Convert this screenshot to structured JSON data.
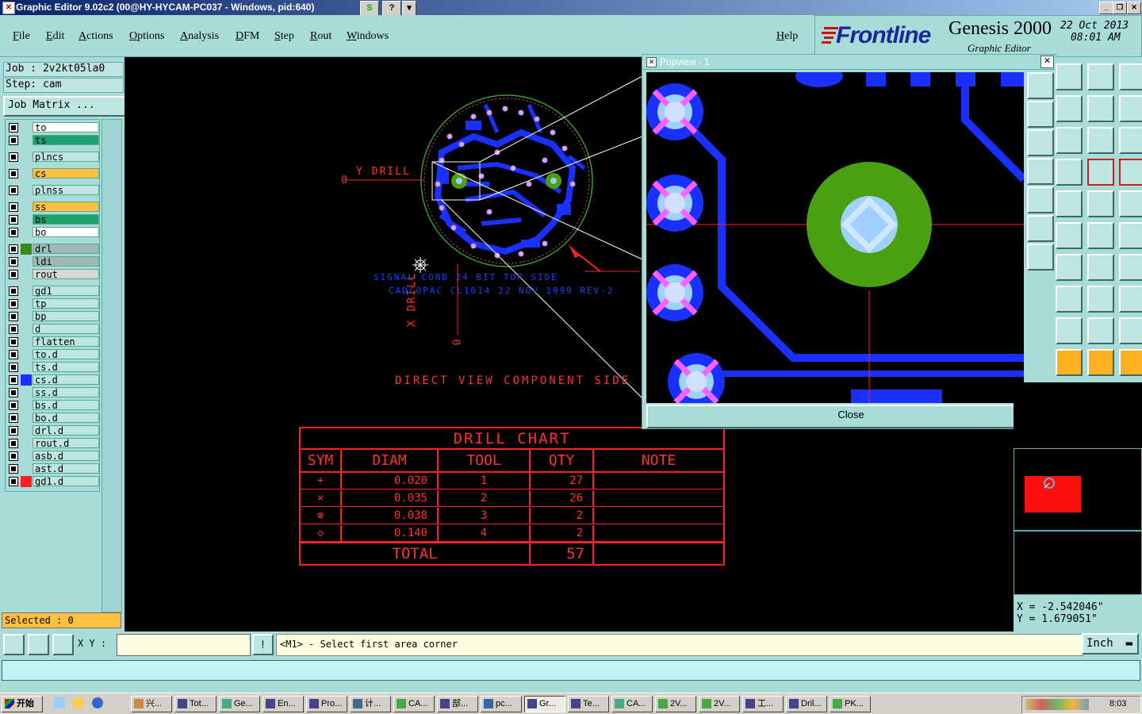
{
  "window": {
    "title": "Graphic Editor 9.02c2 (00@HY-HYCAM-PC037 - Windows, pid:640)",
    "qbtn1": "S",
    "qbtn2": "?",
    "qbtn3": "▾"
  },
  "menu": [
    "File",
    "Edit",
    "Actions",
    "Options",
    "Analysis",
    "DFM",
    "Step",
    "Rout",
    "Windows"
  ],
  "help": "Help",
  "logo": {
    "brand": "Frontline",
    "product": "Genesis 2000",
    "subtitle": "Graphic Editor",
    "date": "22 Oct 2013",
    "time": "08:01 AM"
  },
  "job": {
    "job": "Job : 2v2kt05la0",
    "step": "Step: cam",
    "matrix_button": "Job Matrix ..."
  },
  "layers": [
    {
      "name": "to",
      "color": "#ffffff",
      "gap": false
    },
    {
      "name": "ts",
      "color": "#1fa070",
      "gap": false
    },
    {
      "name": "plncs",
      "color": "#bde6e2",
      "gap": true
    },
    {
      "name": "cs",
      "color": "#ffc040",
      "gap": true
    },
    {
      "name": "plnss",
      "color": "#bde6e2",
      "gap": true
    },
    {
      "name": "ss",
      "color": "#ffc040",
      "gap": true
    },
    {
      "name": "bs",
      "color": "#1fa070",
      "gap": false
    },
    {
      "name": "bo",
      "color": "#ffffff",
      "gap": false
    },
    {
      "name": "drl",
      "color": "#a0b8b8",
      "gap": true,
      "swatch": "#3a8a1a"
    },
    {
      "name": "ldi",
      "color": "#a0b8b8",
      "gap": false
    },
    {
      "name": "rout",
      "color": "#d8d8d8",
      "gap": false
    },
    {
      "name": "gd1",
      "color": "#bde6e2",
      "gap": true
    },
    {
      "name": "tp",
      "color": "#bde6e2",
      "gap": false
    },
    {
      "name": "bp",
      "color": "#bde6e2",
      "gap": false
    },
    {
      "name": "d",
      "color": "#bde6e2",
      "gap": false
    },
    {
      "name": "flatten",
      "color": "#bde6e2",
      "gap": false
    },
    {
      "name": "to.d",
      "color": "#bde6e2",
      "gap": false
    },
    {
      "name": "ts.d",
      "color": "#bde6e2",
      "gap": false
    },
    {
      "name": "cs.d",
      "color": "#bde6e2",
      "gap": false,
      "swatch": "#1a30ff"
    },
    {
      "name": "ss.d",
      "color": "#bde6e2",
      "gap": false
    },
    {
      "name": "bs.d",
      "color": "#bde6e2",
      "gap": false
    },
    {
      "name": "bo.d",
      "color": "#bde6e2",
      "gap": false
    },
    {
      "name": "drl.d",
      "color": "#bde6e2",
      "gap": false
    },
    {
      "name": "rout.d",
      "color": "#bde6e2",
      "gap": false
    },
    {
      "name": "asb.d",
      "color": "#bde6e2",
      "gap": false
    },
    {
      "name": "ast.d",
      "color": "#bde6e2",
      "gap": false
    },
    {
      "name": "gd1.d",
      "color": "#bde6e2",
      "gap": false,
      "swatch": "#ff2020",
      "selected": true
    }
  ],
  "selected": "Selected : 0",
  "canvas": {
    "y_drill": "Y DRILL",
    "x_drill": "X DRILL",
    "zero": "0",
    "sig_line1": "SIGNAL COND 24 BIT  TOP SIDE",
    "sig_line2": "CADCOPAC CL1014  22 NOV 1999  REV-2",
    "direct_view": "DIRECT VIEW  COMPONENT SIDE"
  },
  "drill_chart": {
    "title": "DRILL CHART",
    "headers": [
      "SYM",
      "DIAM",
      "TOOL",
      "QTY",
      "NOTE"
    ],
    "rows": [
      {
        "sym": "+",
        "diam": "0.020",
        "tool": "1",
        "qty": "27",
        "note": ""
      },
      {
        "sym": "×",
        "diam": "0.035",
        "tool": "2",
        "qty": "26",
        "note": ""
      },
      {
        "sym": "⊗",
        "diam": "0.038",
        "tool": "3",
        "qty": "2",
        "note": ""
      },
      {
        "sym": "◇",
        "diam": "0.140",
        "tool": "4",
        "qty": "2",
        "note": ""
      }
    ],
    "total_label": "TOTAL",
    "total_qty": "57"
  },
  "popview": {
    "title": "Popview - 1",
    "close": "Close"
  },
  "coords": {
    "x": "X = -2.542046\"",
    "y": "Y = 1.679051\""
  },
  "cmd": {
    "xy_label": "X Y :",
    "message": "<M1> - Select first area corner",
    "unit": "Inch"
  },
  "taskbar": {
    "start": "开始",
    "items": [
      "兴...",
      "Tot...",
      "Ge...",
      "En...",
      "Pro...",
      "计...",
      "CA...",
      "部...",
      "pc...",
      "Gr...",
      "Te...",
      "CA...",
      "2V...",
      "2V...",
      "工...",
      "Dril...",
      "PK..."
    ],
    "active_index": 9,
    "clock": "8:03"
  },
  "colors": {
    "panel": "#a8dcd8",
    "copper": "#1a30ff",
    "pad": "#4aa010",
    "drill": "#a0c8ff",
    "outline": "#ff2020"
  }
}
